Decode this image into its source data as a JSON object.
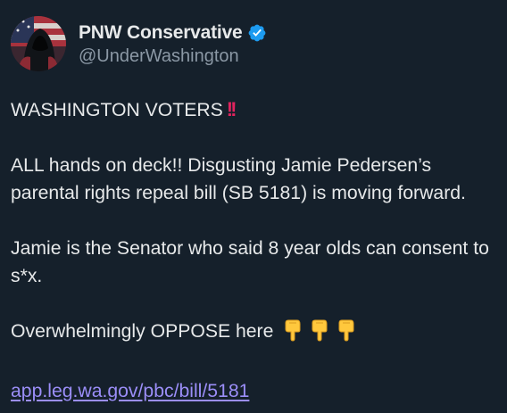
{
  "account": {
    "display_name": "PNW Conservative",
    "handle": "@UnderWashington",
    "verified": true,
    "avatar_icon": "hooded-figure-flag-avatar"
  },
  "post": {
    "heading": "WASHINGTON VOTERS",
    "heading_emoji": "‼️",
    "para1": "ALL hands on deck!! Disgusting Jamie Pedersen’s parental rights repeal bill (SB 5181) is moving forward.",
    "para2": "Jamie is the Senator who said 8 year olds can consent to s*x.",
    "para3": "Overwhelmingly OPPOSE here",
    "para3_emojis": [
      "point-down-icon",
      "point-down-icon",
      "point-down-icon"
    ],
    "link": "app.leg.wa.gov/pbc/bill/5181"
  },
  "colors": {
    "background": "#15202b",
    "text": "#e7e9ea",
    "handle": "#8b98a5",
    "verified": "#1d9bf0",
    "link": "#9b8ef8",
    "emoji_red": "#e0245e"
  }
}
